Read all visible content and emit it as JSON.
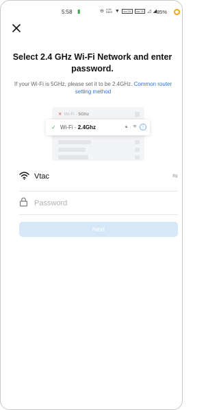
{
  "status_bar": {
    "time": "5:58",
    "battery": "85%",
    "net_speed": "4.00 KB/S",
    "icons": [
      "silent-icon",
      "wifi-icon",
      "volte-icon",
      "volte-icon",
      "signal-icon",
      "signal-icon",
      "battery-saver-icon"
    ]
  },
  "header": {
    "close_icon": "close-icon"
  },
  "title": "Select 2.4 GHz Wi-Fi Network and enter password.",
  "subtitle": {
    "text": "If your Wi-Fi is 5GHz, please set it to be 2.4GHz.",
    "link": "Common router setting method"
  },
  "illustration": {
    "row_5g_prefix": "Wi-Fi - ",
    "row_5g_band": "5Ghz",
    "row_24g_prefix": "Wi-Fi - ",
    "row_24g_band": "2.4Ghz"
  },
  "wifi": {
    "network_name": "Vtac",
    "icon": "wifi-icon",
    "switch_icon": "switch-network-icon"
  },
  "password": {
    "value": "",
    "placeholder": "Password",
    "icon": "lock-icon"
  },
  "next_label": "Next",
  "colors": {
    "link": "#2a74d8",
    "next_disabled": "#d6e7f8",
    "check_green": "#2dae57",
    "x_red": "#e04a4a"
  }
}
